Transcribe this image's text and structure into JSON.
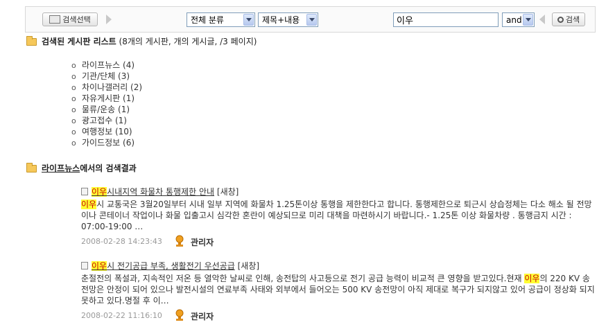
{
  "search": {
    "select_board_label": "검색선택",
    "category_value": "전체 분류",
    "field_value": "제목+내용",
    "query_value": "이우",
    "operator_value": "and",
    "search_button_label": "검색"
  },
  "boards_section": {
    "title_bold": "검색된 게시판 리스트",
    "title_suffix": " (8개의 게시판, 개의 게시글, /3 페이지)",
    "items": [
      "라이프뉴스 (4)",
      "기관/단체 (3)",
      "차이나갤러리 (2)",
      "자유게시판 (1)",
      "물류/운송 (1)",
      "광고접수 (1)",
      "여행정보 (10)",
      "가이드정보 (6)"
    ]
  },
  "results_section": {
    "board_name": "라이프뉴스",
    "title_suffix": "에서의 검색결과"
  },
  "results": [
    {
      "title_highlight": "이우",
      "title_rest": "시내지역 화물차 통행제한 안내",
      "window_label": "[새창]",
      "body_parts": [
        {
          "text": "이우",
          "hl": true
        },
        {
          "text": "시 교통국은 3월20일부터 시내 일부 지역에 화물차 1.25톤이상 통행을 제한한다고 합니다. 통행제한으로 퇴근시 상습정체는 다소 해소 될 전망이나 콘테이너 작업이나 화물 입출고시 심각한 혼란이 예상되므로 미리 대책을 마련하시기 바랍니다.- 1.25톤 이상 화물차량  . 통행금지 시간 : 07:00-19:00 …",
          "hl": false
        }
      ],
      "date": "2008-02-28 14:23:43",
      "author": "관리자"
    },
    {
      "title_highlight": "이우",
      "title_rest": "시 전기공급 부족, 생활전기 우선공급",
      "window_label": "[새창]",
      "body_parts": [
        {
          "text": "춘절전의 폭설과, 지속적인 저온 등 열악한 날씨로 인해, 송전탑의 사고등으로 전기 공급 능력이 비교적 큰 영향을 받고있다.현재 ",
          "hl": false
        },
        {
          "text": "이우",
          "hl": true
        },
        {
          "text": "의 220 KV 송전망은 안정이 되어 있으나 발전시설의 연료부족 사태와 외부에서 들어오는 500 KV 송전망이 아직 제대로 복구가 되지않고 있어 공급이 정상화 되지 못하고 있다.명절 후 이…",
          "hl": false
        }
      ],
      "date": "2008-02-22 11:16:10",
      "author": "관리자"
    }
  ],
  "colors": {
    "highlight_bg": "#ffff33",
    "highlight_text": "#c60000",
    "folder": "#f6c85a",
    "date_text": "#999999"
  }
}
